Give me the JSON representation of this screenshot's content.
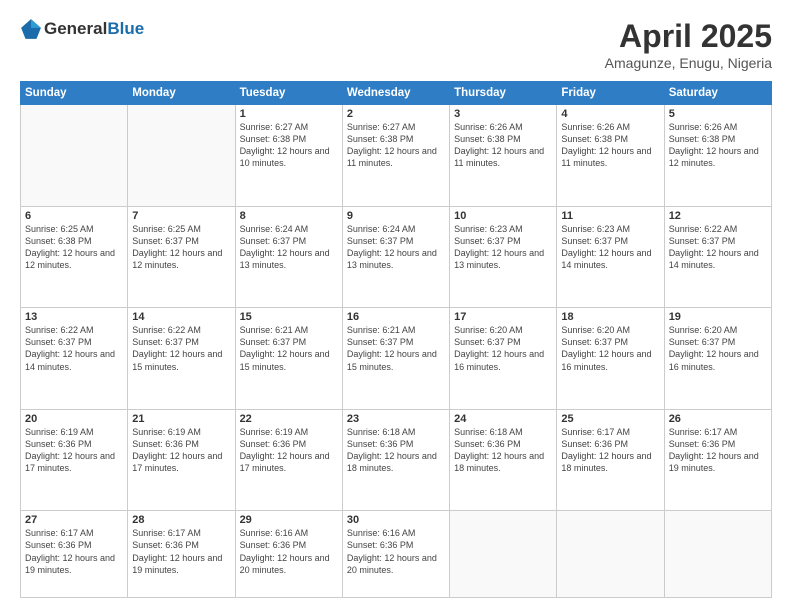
{
  "header": {
    "logo_general": "General",
    "logo_blue": "Blue",
    "title": "April 2025",
    "location": "Amagunze, Enugu, Nigeria"
  },
  "weekdays": [
    "Sunday",
    "Monday",
    "Tuesday",
    "Wednesday",
    "Thursday",
    "Friday",
    "Saturday"
  ],
  "weeks": [
    [
      {
        "day": "",
        "info": ""
      },
      {
        "day": "",
        "info": ""
      },
      {
        "day": "1",
        "info": "Sunrise: 6:27 AM\nSunset: 6:38 PM\nDaylight: 12 hours and 10 minutes."
      },
      {
        "day": "2",
        "info": "Sunrise: 6:27 AM\nSunset: 6:38 PM\nDaylight: 12 hours and 11 minutes."
      },
      {
        "day": "3",
        "info": "Sunrise: 6:26 AM\nSunset: 6:38 PM\nDaylight: 12 hours and 11 minutes."
      },
      {
        "day": "4",
        "info": "Sunrise: 6:26 AM\nSunset: 6:38 PM\nDaylight: 12 hours and 11 minutes."
      },
      {
        "day": "5",
        "info": "Sunrise: 6:26 AM\nSunset: 6:38 PM\nDaylight: 12 hours and 12 minutes."
      }
    ],
    [
      {
        "day": "6",
        "info": "Sunrise: 6:25 AM\nSunset: 6:38 PM\nDaylight: 12 hours and 12 minutes."
      },
      {
        "day": "7",
        "info": "Sunrise: 6:25 AM\nSunset: 6:37 PM\nDaylight: 12 hours and 12 minutes."
      },
      {
        "day": "8",
        "info": "Sunrise: 6:24 AM\nSunset: 6:37 PM\nDaylight: 12 hours and 13 minutes."
      },
      {
        "day": "9",
        "info": "Sunrise: 6:24 AM\nSunset: 6:37 PM\nDaylight: 12 hours and 13 minutes."
      },
      {
        "day": "10",
        "info": "Sunrise: 6:23 AM\nSunset: 6:37 PM\nDaylight: 12 hours and 13 minutes."
      },
      {
        "day": "11",
        "info": "Sunrise: 6:23 AM\nSunset: 6:37 PM\nDaylight: 12 hours and 14 minutes."
      },
      {
        "day": "12",
        "info": "Sunrise: 6:22 AM\nSunset: 6:37 PM\nDaylight: 12 hours and 14 minutes."
      }
    ],
    [
      {
        "day": "13",
        "info": "Sunrise: 6:22 AM\nSunset: 6:37 PM\nDaylight: 12 hours and 14 minutes."
      },
      {
        "day": "14",
        "info": "Sunrise: 6:22 AM\nSunset: 6:37 PM\nDaylight: 12 hours and 15 minutes."
      },
      {
        "day": "15",
        "info": "Sunrise: 6:21 AM\nSunset: 6:37 PM\nDaylight: 12 hours and 15 minutes."
      },
      {
        "day": "16",
        "info": "Sunrise: 6:21 AM\nSunset: 6:37 PM\nDaylight: 12 hours and 15 minutes."
      },
      {
        "day": "17",
        "info": "Sunrise: 6:20 AM\nSunset: 6:37 PM\nDaylight: 12 hours and 16 minutes."
      },
      {
        "day": "18",
        "info": "Sunrise: 6:20 AM\nSunset: 6:37 PM\nDaylight: 12 hours and 16 minutes."
      },
      {
        "day": "19",
        "info": "Sunrise: 6:20 AM\nSunset: 6:37 PM\nDaylight: 12 hours and 16 minutes."
      }
    ],
    [
      {
        "day": "20",
        "info": "Sunrise: 6:19 AM\nSunset: 6:36 PM\nDaylight: 12 hours and 17 minutes."
      },
      {
        "day": "21",
        "info": "Sunrise: 6:19 AM\nSunset: 6:36 PM\nDaylight: 12 hours and 17 minutes."
      },
      {
        "day": "22",
        "info": "Sunrise: 6:19 AM\nSunset: 6:36 PM\nDaylight: 12 hours and 17 minutes."
      },
      {
        "day": "23",
        "info": "Sunrise: 6:18 AM\nSunset: 6:36 PM\nDaylight: 12 hours and 18 minutes."
      },
      {
        "day": "24",
        "info": "Sunrise: 6:18 AM\nSunset: 6:36 PM\nDaylight: 12 hours and 18 minutes."
      },
      {
        "day": "25",
        "info": "Sunrise: 6:17 AM\nSunset: 6:36 PM\nDaylight: 12 hours and 18 minutes."
      },
      {
        "day": "26",
        "info": "Sunrise: 6:17 AM\nSunset: 6:36 PM\nDaylight: 12 hours and 19 minutes."
      }
    ],
    [
      {
        "day": "27",
        "info": "Sunrise: 6:17 AM\nSunset: 6:36 PM\nDaylight: 12 hours and 19 minutes."
      },
      {
        "day": "28",
        "info": "Sunrise: 6:17 AM\nSunset: 6:36 PM\nDaylight: 12 hours and 19 minutes."
      },
      {
        "day": "29",
        "info": "Sunrise: 6:16 AM\nSunset: 6:36 PM\nDaylight: 12 hours and 20 minutes."
      },
      {
        "day": "30",
        "info": "Sunrise: 6:16 AM\nSunset: 6:36 PM\nDaylight: 12 hours and 20 minutes."
      },
      {
        "day": "",
        "info": ""
      },
      {
        "day": "",
        "info": ""
      },
      {
        "day": "",
        "info": ""
      }
    ]
  ]
}
